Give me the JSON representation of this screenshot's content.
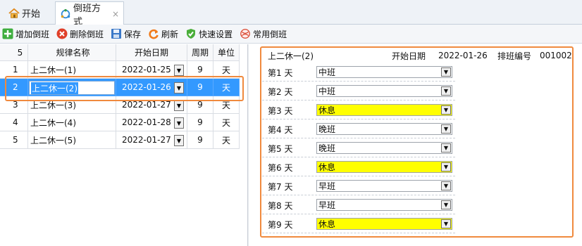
{
  "tabs": [
    {
      "label": "开始",
      "icon": "home-icon"
    },
    {
      "label": "倒班方式",
      "icon": "shift-cycle-icon",
      "close": "×"
    }
  ],
  "toolbar": {
    "add_label": "增加倒班",
    "delete_label": "删除倒班",
    "save_label": "保存",
    "refresh_label": "刷新",
    "quick_label": "快速设置",
    "common_label": "常用倒班"
  },
  "grid": {
    "count": "5",
    "columns": [
      "规律名称",
      "开始日期",
      "周期",
      "单位"
    ],
    "rows": [
      {
        "idx": "1",
        "name": "上二休一(1)",
        "date": "2022-01-25",
        "period": "9",
        "unit": "天"
      },
      {
        "idx": "2",
        "name": "上二休一(2)",
        "date": "2022-01-26",
        "period": "9",
        "unit": "天"
      },
      {
        "idx": "3",
        "name": "上二休一(3)",
        "date": "2022-01-27",
        "period": "9",
        "unit": "天"
      },
      {
        "idx": "4",
        "name": "上二休一(4)",
        "date": "2022-01-28",
        "period": "9",
        "unit": "天"
      },
      {
        "idx": "5",
        "name": "上二休一(5)",
        "date": "2022-01-27",
        "period": "9",
        "unit": "天"
      }
    ],
    "selected_index": 1
  },
  "detail": {
    "title": "上二休一(2)",
    "start_date_label": "开始日期",
    "start_date": "2022-01-26",
    "code_label": "排班编号",
    "code": "001002",
    "days": [
      {
        "label": "第1 天",
        "shift": "中班"
      },
      {
        "label": "第2 天",
        "shift": "中班"
      },
      {
        "label": "第3 天",
        "shift": "休息"
      },
      {
        "label": "第4 天",
        "shift": "晚班"
      },
      {
        "label": "第5 天",
        "shift": "晚班"
      },
      {
        "label": "第6 天",
        "shift": "休息"
      },
      {
        "label": "第7 天",
        "shift": "早班"
      },
      {
        "label": "第8 天",
        "shift": "早班"
      },
      {
        "label": "第9 天",
        "shift": "休息"
      }
    ]
  },
  "colors": {
    "selection": "#3399ff",
    "highlight_box": "#f08a3e",
    "rest_day": "#ffff00"
  }
}
